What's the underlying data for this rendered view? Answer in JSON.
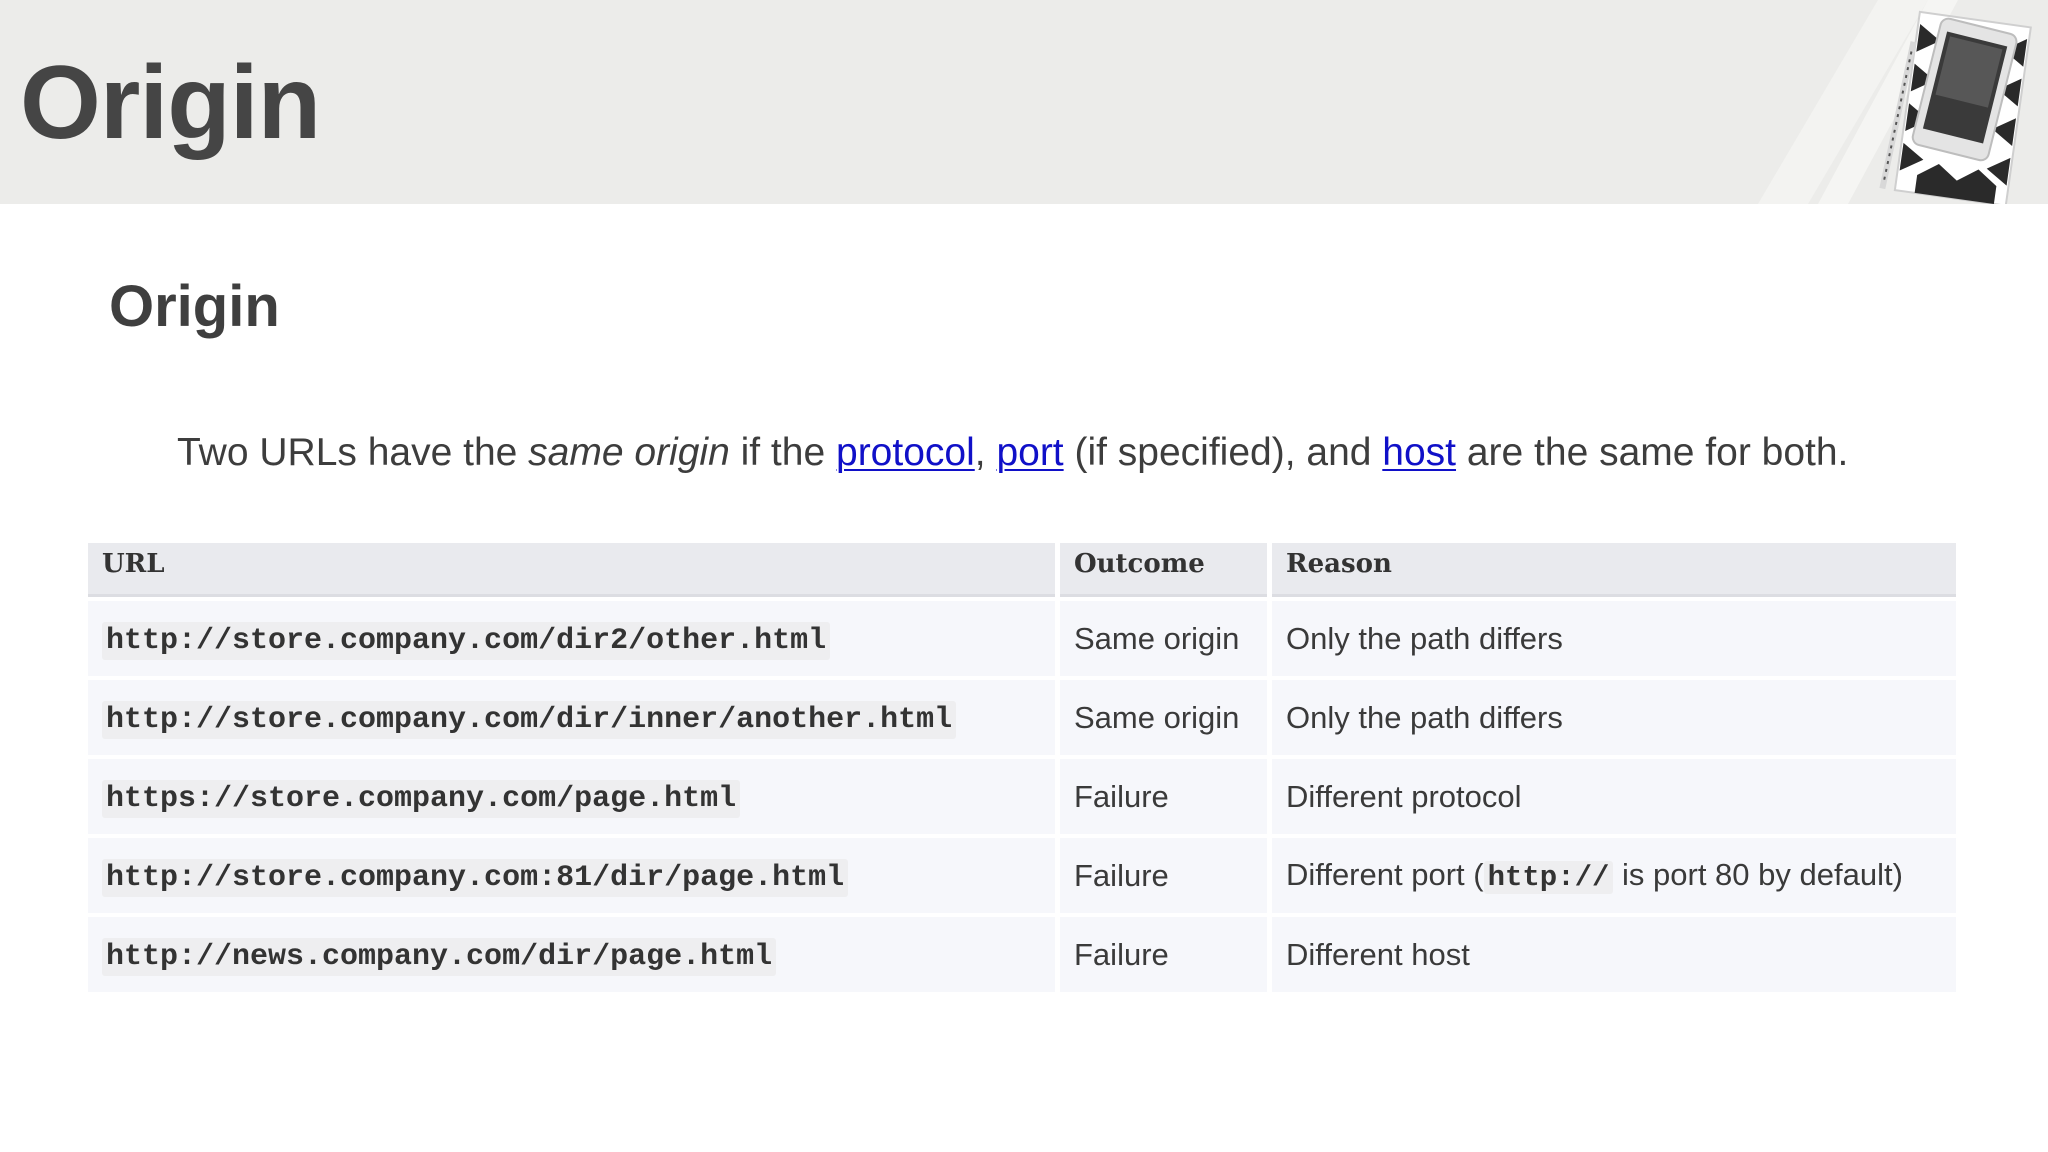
{
  "banner": {
    "title": "Origin"
  },
  "section": {
    "title": "Origin"
  },
  "intro": {
    "part1": "Two URLs have the ",
    "em": "same origin",
    "part2": " if the ",
    "link_protocol": "protocol",
    "comma": ",",
    "space": " ",
    "link_port": "port",
    "part3": " (if specified), and ",
    "link_host": "host",
    "part4": " are the same for both."
  },
  "table": {
    "headers": [
      "URL",
      "Outcome",
      "Reason"
    ],
    "rows": [
      {
        "url": "http://store.company.com/dir2/other.html",
        "outcome": "Same origin",
        "reason": "Only the path differs"
      },
      {
        "url": "http://store.company.com/dir/inner/another.html",
        "outcome": "Same origin",
        "reason": "Only the path differs"
      },
      {
        "url": "https://store.company.com/page.html",
        "outcome": "Failure",
        "reason": "Different protocol"
      },
      {
        "url": "http://store.company.com:81/dir/page.html",
        "outcome": "Failure",
        "reason_pre": "Different port (",
        "reason_code": "http://",
        "reason_post": " is port 80 by default)"
      },
      {
        "url": "http://news.company.com/dir/page.html",
        "outcome": "Failure",
        "reason": "Different host"
      }
    ]
  },
  "colors": {
    "banner_bg": "#ececea",
    "link": "#1010c8",
    "header_bg": "#e9eaee",
    "row_bg": "#f6f7fb"
  }
}
